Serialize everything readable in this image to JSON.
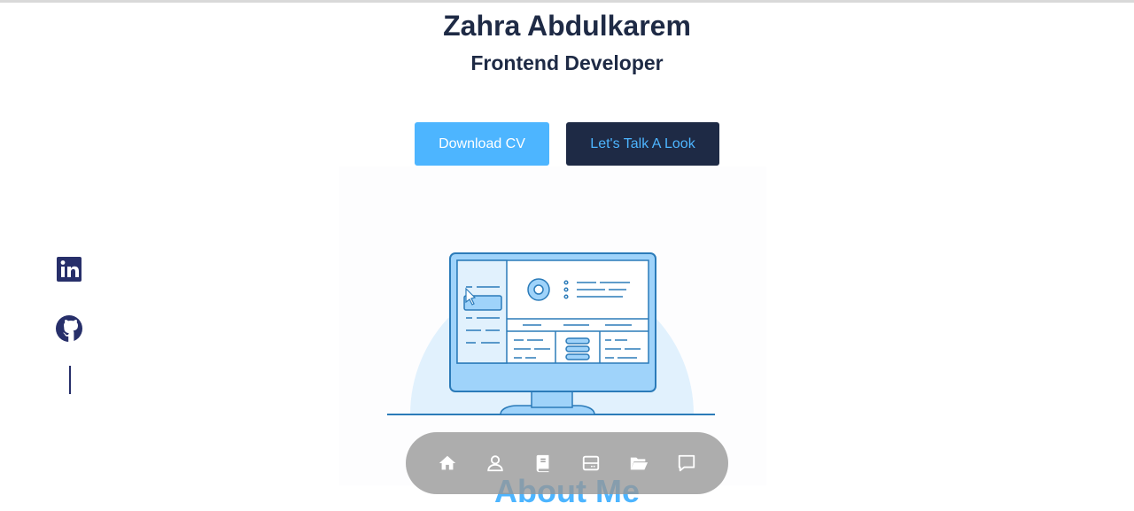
{
  "profile": {
    "name": "Zahra Abdulkarem",
    "role": "Frontend Developer"
  },
  "actions": {
    "download_cv": "Download CV",
    "talk": "Let's Talk A Look"
  },
  "socials": [
    {
      "icon": "linkedin-icon"
    },
    {
      "icon": "github-icon"
    }
  ],
  "sections": {
    "about_title": "About Me"
  },
  "nav": [
    {
      "icon": "home-icon"
    },
    {
      "icon": "user-icon"
    },
    {
      "icon": "book-icon"
    },
    {
      "icon": "server-icon"
    },
    {
      "icon": "folder-icon"
    },
    {
      "icon": "message-icon"
    }
  ],
  "colors": {
    "primary": "#1e2a45",
    "accent": "#4db5ff",
    "dock": "#969696"
  }
}
